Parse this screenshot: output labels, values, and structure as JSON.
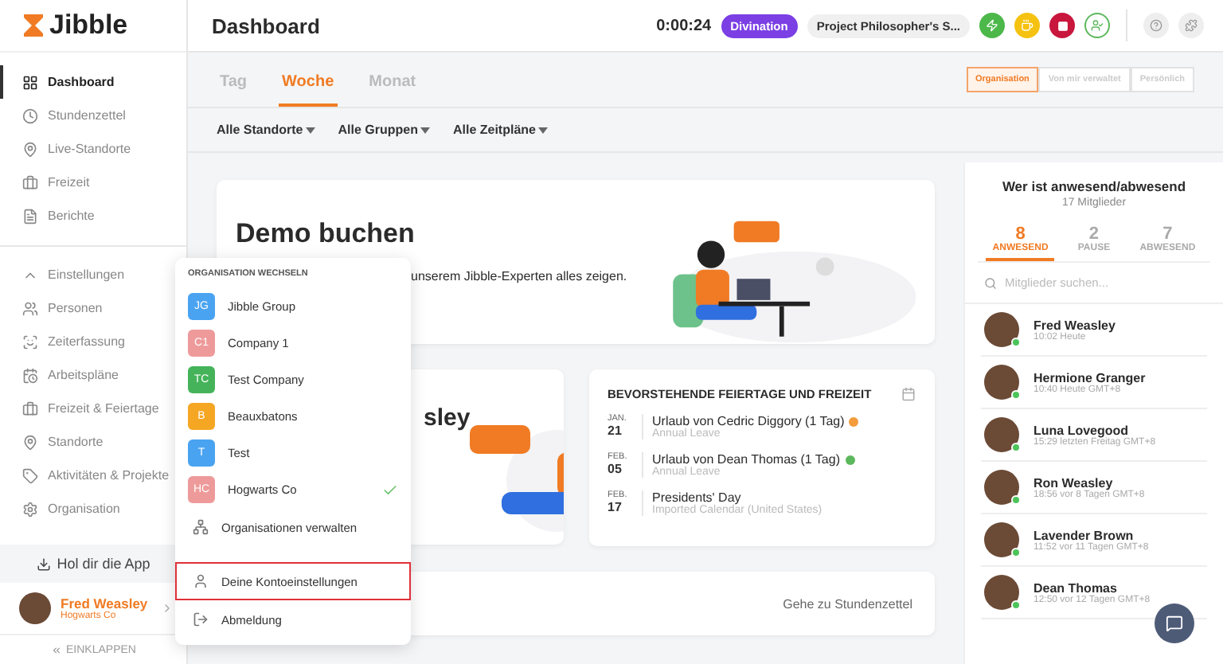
{
  "logo": {
    "text": "Jibble"
  },
  "header": {
    "title": "Dashboard",
    "timer": "0:00:24",
    "activity": "Divination",
    "project": "Project Philosopher's S..."
  },
  "sidebar": {
    "items": [
      {
        "label": "Dashboard",
        "selected": true
      },
      {
        "label": "Stundenzettel",
        "selected": false
      },
      {
        "label": "Live-Standorte",
        "selected": false
      },
      {
        "label": "Freizeit",
        "selected": false
      },
      {
        "label": "Berichte",
        "selected": false
      }
    ],
    "settings": {
      "label": "Einstellungen",
      "expanded": true,
      "children": [
        {
          "label": "Personen"
        },
        {
          "label": "Zeiterfassung"
        },
        {
          "label": "Arbeitspläne"
        },
        {
          "label": "Freizeit & Feiertage"
        },
        {
          "label": "Standorte"
        },
        {
          "label": "Aktivitäten & Projekte"
        },
        {
          "label": "Organisation"
        }
      ]
    },
    "get_app": "Hol dir die App",
    "user": {
      "name": "Fred Weasley",
      "org": "Hogwarts Co"
    },
    "collapse": "EINKLAPPEN"
  },
  "tabs": [
    {
      "label": "Tag",
      "selected": false
    },
    {
      "label": "Woche",
      "selected": true
    },
    {
      "label": "Monat",
      "selected": false
    }
  ],
  "scope": [
    {
      "label": "Organisation",
      "selected": true
    },
    {
      "label": "Von mir verwaltet",
      "selected": false
    },
    {
      "label": "Persönlich",
      "selected": false
    }
  ],
  "filters": [
    "Alle Standorte",
    "Alle Gruppen",
    "Alle Zeitpläne"
  ],
  "demo_card": {
    "title": "Demo buchen",
    "text": "unserem Jibble-Experten alles zeigen."
  },
  "welcome_card": {
    "title": "sley"
  },
  "holidays": {
    "title": "BEVORSTEHENDE FEIERTAGE UND FREIZEIT",
    "items": [
      {
        "month": "JAN.",
        "day": "21",
        "title": "Urlaub von Cedric Diggory (1 Tag)",
        "subtitle": "Annual Leave",
        "color": "#f39c3c"
      },
      {
        "month": "FEB.",
        "day": "05",
        "title": "Urlaub von Dean Thomas (1 Tag)",
        "subtitle": "Annual Leave",
        "color": "#5cb85c"
      },
      {
        "month": "FEB.",
        "day": "17",
        "title": "Presidents' Day",
        "subtitle": "Imported Calendar (United States)"
      }
    ]
  },
  "timesheet_card": {
    "link": "Gehe zu Stundenzettel"
  },
  "presence": {
    "title": "Wer ist anwesend/abwesend",
    "count": "17 Mitglieder",
    "stats": [
      {
        "value": "8",
        "label": "ANWESEND",
        "selected": true
      },
      {
        "value": "2",
        "label": "PAUSE",
        "selected": false
      },
      {
        "value": "7",
        "label": "ABWESEND",
        "selected": false
      }
    ],
    "search": {
      "placeholder": "Mitglieder suchen..."
    },
    "members": [
      {
        "name": "Fred Weasley",
        "time": "10:02 Heute",
        "online": true
      },
      {
        "name": "Hermione Granger",
        "time": "10:40 Heute GMT+8",
        "online": true
      },
      {
        "name": "Luna Lovegood",
        "time": "15:29 letzten Freitag GMT+8",
        "online": true
      },
      {
        "name": "Ron Weasley",
        "time": "18:56 vor 8 Tagen GMT+8",
        "online": true
      },
      {
        "name": "Lavender Brown",
        "time": "11:52 vor 11 Tagen GMT+8",
        "online": true
      },
      {
        "name": "Dean Thomas",
        "time": "12:50 vor 12 Tagen GMT+8",
        "online": true
      }
    ]
  },
  "org_menu": {
    "title": "ORGANISATION WECHSELN",
    "orgs": [
      {
        "initials": "JG",
        "name": "Jibble Group",
        "color": "#4aa3f0",
        "selected": false
      },
      {
        "initials": "C1",
        "name": "Company 1",
        "color": "#ee9a9a",
        "selected": false
      },
      {
        "initials": "TC",
        "name": "Test Company",
        "color": "#45b35a",
        "selected": false
      },
      {
        "initials": "B",
        "name": "Beauxbatons",
        "color": "#f5a623",
        "selected": false
      },
      {
        "initials": "T",
        "name": "Test",
        "color": "#4aa3f0",
        "selected": false
      },
      {
        "initials": "HC",
        "name": "Hogwarts Co",
        "color": "#ee9a9a",
        "selected": true
      }
    ],
    "actions": [
      {
        "label": "Organisationen verwalten",
        "highlighted": false,
        "divider_before": false
      },
      {
        "label": "Deine Kontoeinstellungen",
        "highlighted": true,
        "divider_before": true
      },
      {
        "label": "Abmeldung",
        "highlighted": false,
        "divider_before": false
      }
    ]
  }
}
